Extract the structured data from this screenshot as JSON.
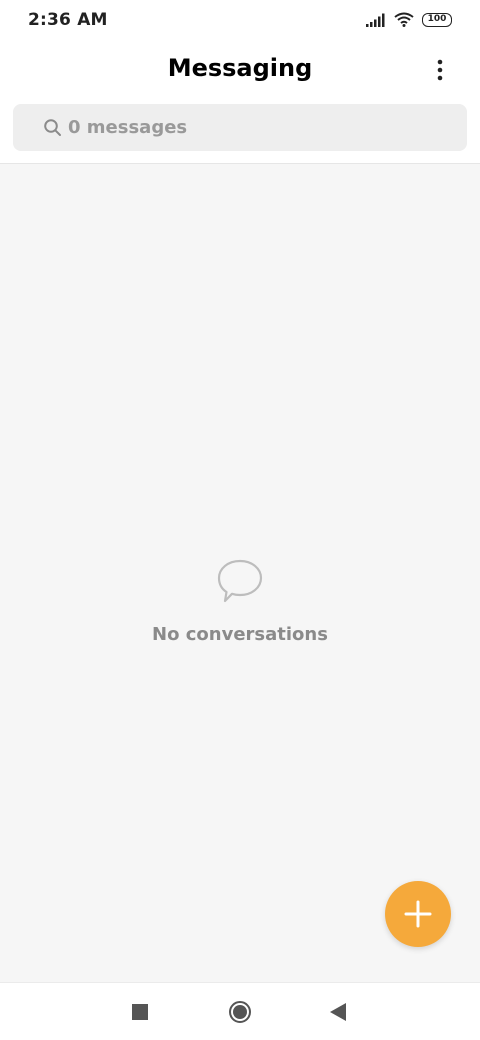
{
  "status_bar": {
    "time": "2:36 AM",
    "battery": "100",
    "icons": [
      "signal-icon",
      "wifi-icon",
      "battery-icon"
    ]
  },
  "header": {
    "title": "Messaging",
    "menu_icon": "more-vert-icon"
  },
  "search": {
    "placeholder": "0 messages",
    "icon": "search-icon"
  },
  "empty_state": {
    "icon": "chat-bubble-icon",
    "text": "No conversations"
  },
  "fab": {
    "icon": "plus-icon",
    "color": "#f5a93b"
  },
  "nav_bar": {
    "buttons": [
      "recents-square-icon",
      "home-circle-icon",
      "back-triangle-icon"
    ]
  },
  "colors": {
    "accent": "#f5a93b",
    "content_bg": "#f6f6f6",
    "search_bg": "#eeeeee"
  }
}
